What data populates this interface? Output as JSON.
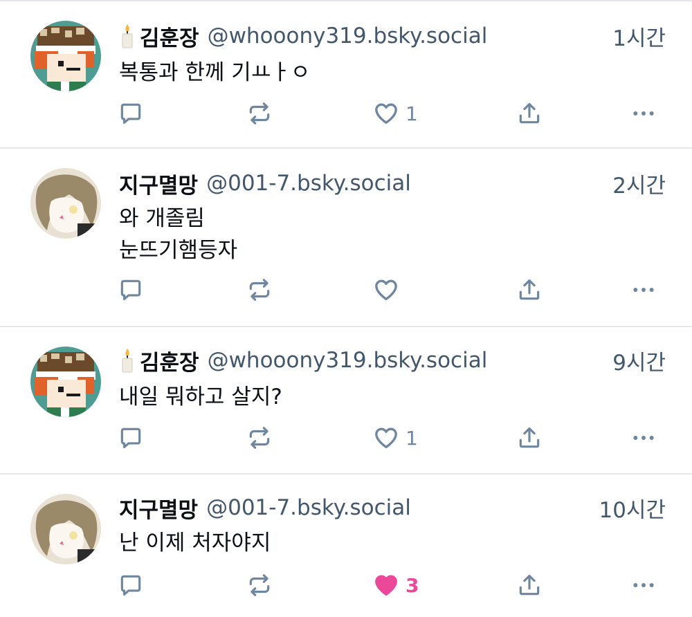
{
  "colors": {
    "text_primary": "#0b0f14",
    "text_secondary": "#42576c",
    "icon": "#6f869f",
    "liked": "#ec4899",
    "divider": "#e4e8ec"
  },
  "posts": [
    {
      "author_name": "김훈장",
      "has_candle_emoji": true,
      "handle": "@whooony319.bsky.social",
      "time": "1시간",
      "text": "복통과 한께 기ㅛㅏㅇ",
      "like_count": "1",
      "liked": false,
      "avatar": "pixel-avatar"
    },
    {
      "author_name": "지구멸망",
      "has_candle_emoji": false,
      "handle": "@001-7.bsky.social",
      "time": "2시간",
      "text": "와 개졸림\n눈뜨기햄등자",
      "like_count": "",
      "liked": false,
      "avatar": "sketch-avatar"
    },
    {
      "author_name": "김훈장",
      "has_candle_emoji": true,
      "handle": "@whooony319.bsky.social",
      "time": "9시간",
      "text": "내일 뭐하고 살지?",
      "like_count": "1",
      "liked": false,
      "avatar": "pixel-avatar"
    },
    {
      "author_name": "지구멸망",
      "has_candle_emoji": false,
      "handle": "@001-7.bsky.social",
      "time": "10시간",
      "text": "난 이제 처자야지",
      "like_count": "3",
      "liked": true,
      "avatar": "sketch-avatar"
    }
  ],
  "icons": {
    "reply": "reply-bubble-icon",
    "repost": "repost-icon",
    "like": "heart-icon",
    "share": "share-icon",
    "more": "more-dots-icon"
  }
}
